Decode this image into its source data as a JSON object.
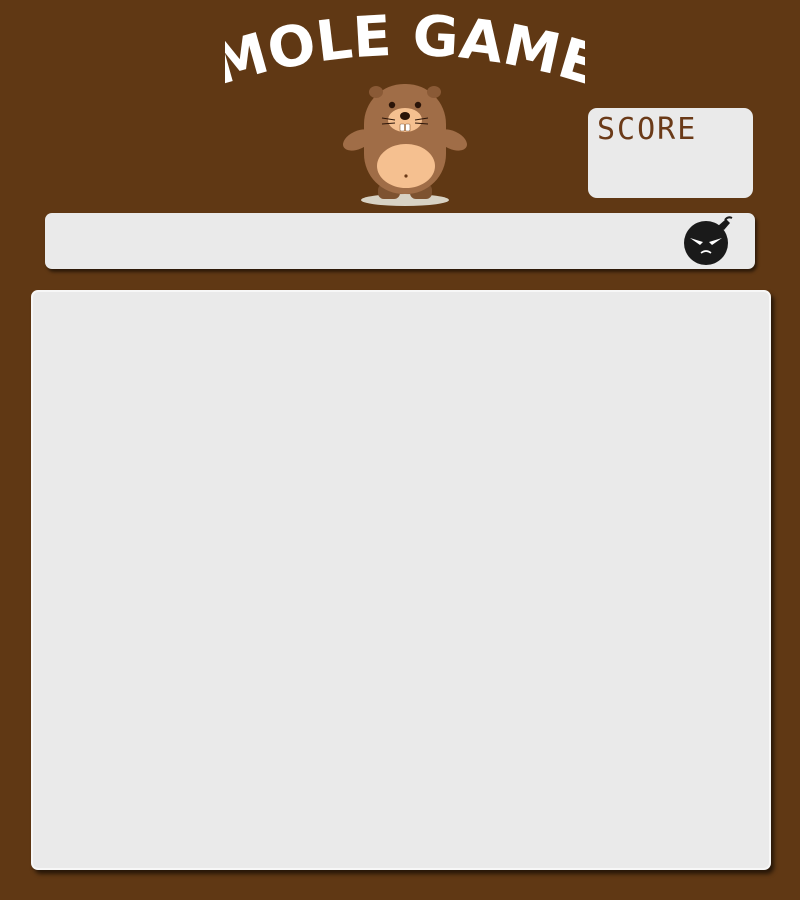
{
  "game": {
    "title": "MOLE GAME",
    "score": {
      "label": "SCORE",
      "value": ""
    }
  },
  "colors": {
    "background": "#603814",
    "panel": "#eaeaea",
    "title_text": "#ffffff",
    "score_label": "#6b3a18",
    "mole_body": "#a06d47",
    "mole_belly": "#f5c090",
    "bomb": "#1a1a1a"
  },
  "icons": {
    "mascot": "mole-icon",
    "bomb": "bomb-icon"
  }
}
